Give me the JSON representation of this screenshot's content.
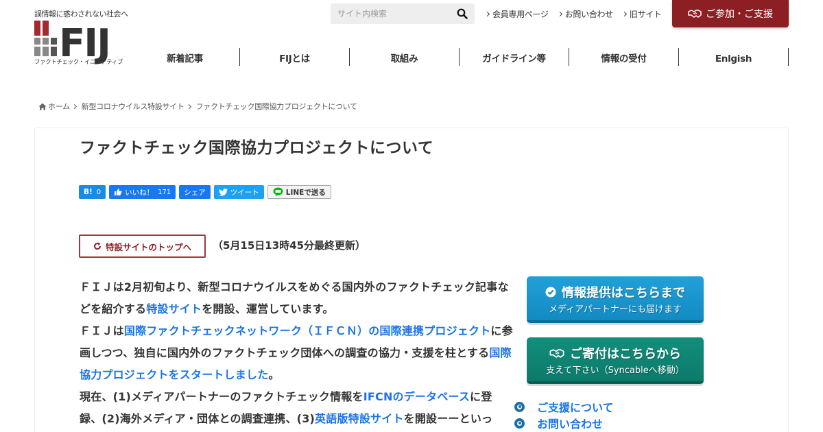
{
  "header": {
    "tagline": "誤情報に惑わされない社会へ",
    "logo_text": "FIJ",
    "logo_sub": "ファクトチェック・イニシアティブ",
    "search_placeholder": "サイト内検索",
    "util_links": [
      {
        "label": "会員専用ページ"
      },
      {
        "label": "お問い合わせ"
      },
      {
        "label": "旧サイト"
      }
    ],
    "join_label": "ご参加・ご支援",
    "nav": [
      {
        "label": "新着記事"
      },
      {
        "label": "FIJとは"
      },
      {
        "label": "取組み"
      },
      {
        "label": "ガイドライン等"
      },
      {
        "label": "情報の受付"
      },
      {
        "label": "Enlgish"
      }
    ]
  },
  "breadcrumb": [
    {
      "label": "ホーム"
    },
    {
      "label": "新型コロナウイルス特設サイト"
    },
    {
      "label": "ファクトチェック国際協力プロジェクトについて"
    }
  ],
  "page_title": "ファクトチェック国際協力プロジェクトについて",
  "share": {
    "hatena_label": "B!",
    "hatena_count": "0",
    "like_label": "いいね！",
    "like_count": "171",
    "share_label": "シェア",
    "tweet_label": "ツイート",
    "line_label": "LINEで送る"
  },
  "top_button_label": "特設サイトのトップへ",
  "updated_text": "（5月15日13時45分最終更新）",
  "article": {
    "p1_a": "ＦＩＪは2月初旬より、新型コロナウイルスをめぐる国内外のファクトチェック記事などを紹介する",
    "p1_link": "特設サイト",
    "p1_b": "を開設、運営しています。",
    "p2_a": "ＦＩＪは",
    "p2_link1": "国際ファクトチェックネットワーク（ＩＦＣＮ）の国際連携プロジェクト",
    "p2_b": "に参画しつつ、独自に国内外のファクトチェック団体への調査の協力・支援を柱とする",
    "p2_link2": "国際協力プロジェクトをスタートしました",
    "p2_c": "。",
    "p3_a": "現在、(1)メディアパートナーのファクトチェック情報を",
    "p3_link1": "IFCNのデータベース",
    "p3_b": "に登録、(2)海外メディア・団体との調査連携、(3)",
    "p3_link2": "英語版特設サイト",
    "p3_c": "を開設ーーといっ"
  },
  "sidebar": {
    "info_main": "情報提供はこちらまで",
    "info_sub": "メディアパートナーにも届けます",
    "donate_main": "ご寄付はこちらから",
    "donate_sub": "支えて下さい（Syncableへ移動）",
    "links": [
      {
        "label": "ご支援について"
      },
      {
        "label": "お問い合わせ"
      }
    ]
  },
  "colors": {
    "brand_red": "#8c1f24",
    "link_blue": "#1a73e8",
    "info_blue": "#138ac2",
    "donate_teal": "#0c7a6a"
  }
}
